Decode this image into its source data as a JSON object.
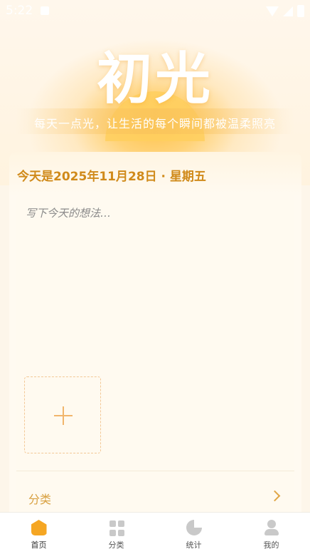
{
  "status_bar": {
    "time": "5:22"
  },
  "header": {
    "brand": "初光",
    "slogan": "每天一点光，让生活的每个瞬间都被温柔照亮"
  },
  "entry": {
    "date_title": "今天是2025年11月28日 · 星期五",
    "placeholder": "写下今天的想法…",
    "category_label": "分类"
  },
  "tabs": [
    {
      "label": "首页",
      "icon": "home-icon",
      "active": true
    },
    {
      "label": "分类",
      "icon": "category-grid-icon",
      "active": false
    },
    {
      "label": "统计",
      "icon": "pie-chart-icon",
      "active": false
    },
    {
      "label": "我的",
      "icon": "user-icon",
      "active": false
    }
  ],
  "colors": {
    "accent": "#f5a623",
    "title": "#d08a1a",
    "background": "#fdf6ea"
  }
}
